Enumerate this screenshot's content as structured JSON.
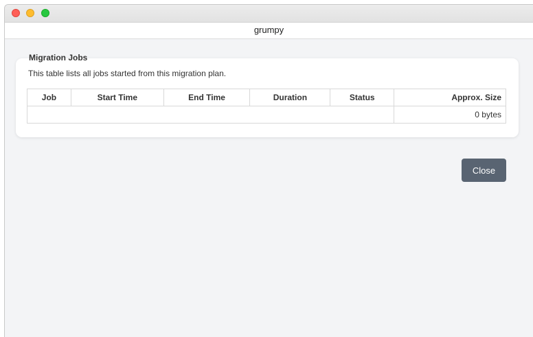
{
  "window": {
    "title": "grumpy"
  },
  "migration_jobs": {
    "title": "Migration Jobs",
    "description": "This table lists all jobs started from this migration plan.",
    "columns": [
      "Job",
      "Start Time",
      "End Time",
      "Duration",
      "Status",
      "Approx. Size"
    ],
    "rows": [
      {
        "job": "",
        "start_time": "",
        "end_time": "",
        "duration": "",
        "status": "",
        "approx_size": "0 bytes"
      }
    ]
  },
  "actions": {
    "close_label": "Close"
  },
  "colors": {
    "close_button": "#596472",
    "window_background": "#f3f4f6",
    "card_background": "#ffffff"
  }
}
